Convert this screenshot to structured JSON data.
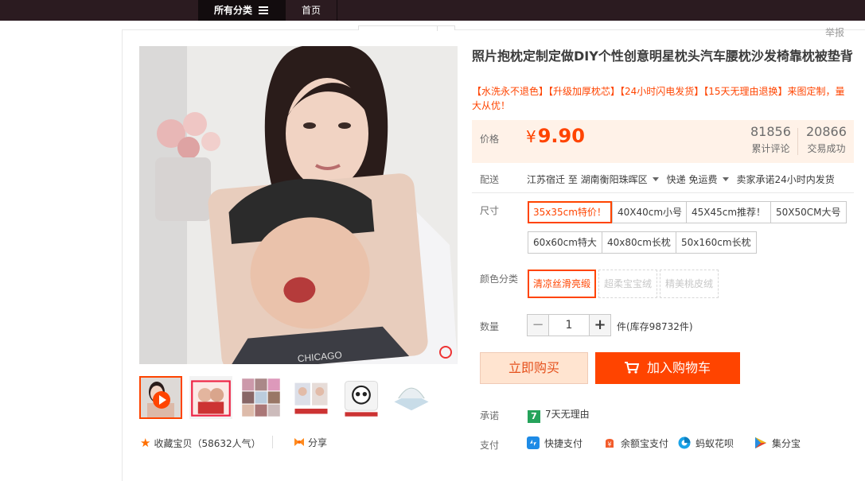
{
  "nav": {
    "categories_label": "所有分类",
    "home_label": "首页"
  },
  "report_label": "举报",
  "product": {
    "title": "照片抱枕定制定做DIY个性创意明星枕头汽车腰枕沙发椅靠枕被垫背",
    "subtitle": "【水洗永不退色】【升级加厚枕芯】【24小时闪电发货】【15天无理由退换】来图定制，量大从优！"
  },
  "price": {
    "label": "价格",
    "currency": "¥",
    "value": "9.90",
    "reviews_count": "81856",
    "reviews_label": "累计评论",
    "sales_count": "20866",
    "sales_label": "交易成功"
  },
  "shipping": {
    "label": "配送",
    "from": "江苏宿迁 至",
    "to": "湖南衡阳珠晖区",
    "method": "快递 免运费",
    "promise": "卖家承诺24小时内发货"
  },
  "size": {
    "label": "尺寸",
    "options": [
      "35x35cm特价！",
      "40X40cm小号",
      "45X45cm推荐！",
      "50X50CM大号",
      "60x60cm特大",
      "40x80cm长枕",
      "50x160cm长枕"
    ]
  },
  "color": {
    "label": "颜色分类",
    "options": [
      "清凉丝滑亮缎",
      "超柔宝宝绒",
      "精美桃皮绒"
    ]
  },
  "quantity": {
    "label": "数量",
    "value": "1",
    "minus": "−",
    "plus": "+",
    "stock": "件(库存98732件)"
  },
  "buttons": {
    "buy_now": "立即购买",
    "add_to_cart": "加入购物车"
  },
  "promise": {
    "label": "承诺",
    "badge": "7",
    "text": "7天无理由"
  },
  "payment": {
    "label": "支付",
    "methods": [
      "快捷支付",
      "余额宝支付",
      "蚂蚁花呗",
      "集分宝"
    ]
  },
  "favorite": {
    "star": "★",
    "text": "收藏宝贝（58632人气）"
  },
  "share_label": "分享",
  "colors": {
    "accent": "#ff4400",
    "nav_bg": "#2b1b20",
    "price_bg": "#fff2e8",
    "buy_now_bg": "#ffe4d0"
  }
}
